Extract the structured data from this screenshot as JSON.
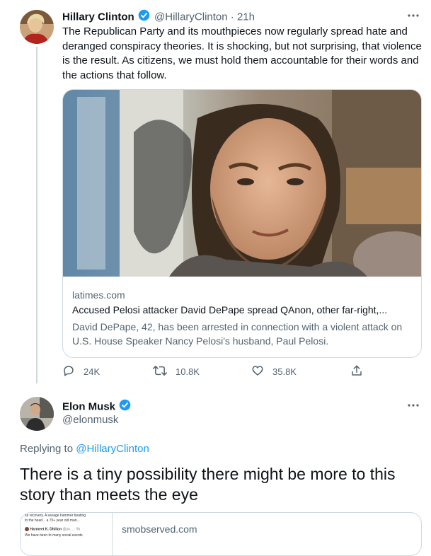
{
  "tweet1": {
    "author_name": "Hillary Clinton",
    "handle": "@HillaryClinton",
    "time": "· 21h",
    "text": "The Republican Party and its mouthpieces now regularly spread hate and deranged conspiracy theories. It is shocking, but not surprising, that violence is the result. As citizens, we must hold them accountable for their words and the actions that follow.",
    "card": {
      "domain": "latimes.com",
      "headline": "Accused Pelosi attacker David DePape spread QAnon, other far-right,...",
      "description": "David DePape, 42, has been arrested in connection with a violent attack on U.S. House Speaker Nancy Pelosi's husband, Paul Pelosi."
    },
    "actions": {
      "reply_count": "24K",
      "retweet_count": "10.8K",
      "like_count": "35.8K"
    }
  },
  "tweet2": {
    "author_name": "Elon Musk",
    "handle": "@elonmusk",
    "replying_prefix": "Replying to",
    "replying_handle": "@HillaryClinton",
    "text": "There is a tiny possibility there might be more to this story than meets the eye",
    "card": {
      "domain": "smobserved.com",
      "thumb_line1": "ful recovery. A savage hammer beating",
      "thumb_line2": "to the head... a 70+ year old man...",
      "thumb_author": "Harmeet K. Dhillon",
      "thumb_meta": "@pn... · 9h",
      "thumb_line3": "We have been to many social events"
    }
  },
  "colors": {
    "accent": "#1d9bf0",
    "text": "#0f1419",
    "muted": "#536471",
    "border": "#cfd9de"
  },
  "icons": [
    "more-icon",
    "verified-badge-icon",
    "reply-icon",
    "retweet-icon",
    "like-icon",
    "share-icon"
  ]
}
